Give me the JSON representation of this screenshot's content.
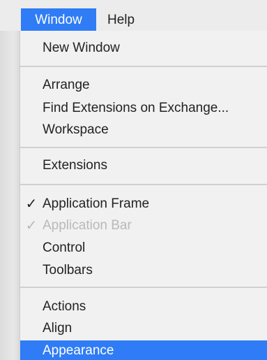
{
  "menubar": {
    "window_label": "Window",
    "help_label": "Help"
  },
  "menu": {
    "new_window": "New Window",
    "arrange": "Arrange",
    "find_extensions": "Find Extensions on Exchange...",
    "workspace": "Workspace",
    "extensions": "Extensions",
    "application_frame": "Application Frame",
    "application_bar": "Application Bar",
    "control": "Control",
    "toolbars": "Toolbars",
    "actions": "Actions",
    "align": "Align",
    "appearance": "Appearance",
    "checkmark": "✓"
  },
  "colors": {
    "highlight": "#2f7cf6",
    "disabled_text": "#b9b9b9"
  }
}
